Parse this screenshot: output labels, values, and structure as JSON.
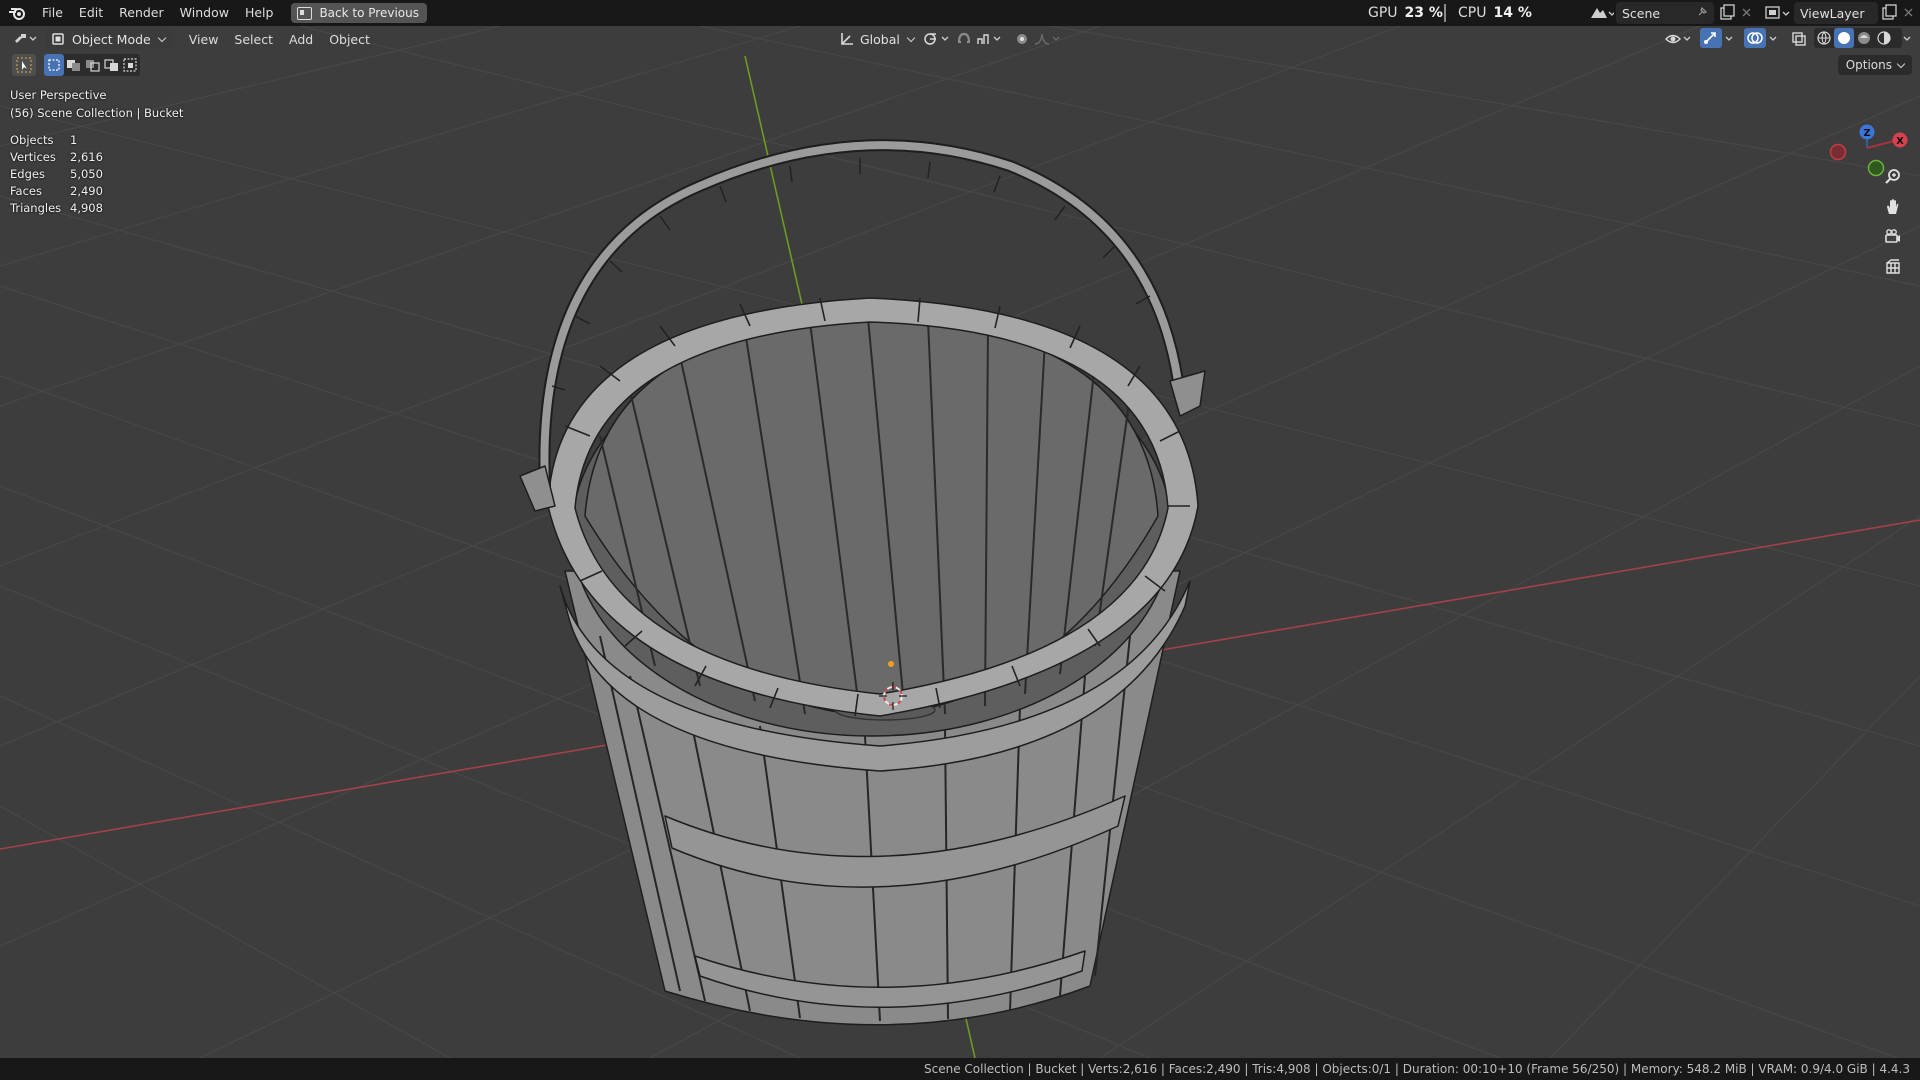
{
  "menu": {
    "items": [
      "File",
      "Edit",
      "Render",
      "Window",
      "Help"
    ],
    "back_button": "Back to Previous"
  },
  "performance": {
    "gpu_label": "GPU",
    "gpu_value": "23 %",
    "cpu_label": "CPU",
    "cpu_value": "14 %"
  },
  "scene": {
    "name": "Scene"
  },
  "view_layer": {
    "name": "ViewLayer"
  },
  "viewport_header": {
    "mode": "Object Mode",
    "menus": [
      "View",
      "Select",
      "Add",
      "Object"
    ],
    "orientation": "Global",
    "options": "Options"
  },
  "overlay": {
    "perspective": "User Perspective",
    "collection": "(56) Scene Collection | Bucket"
  },
  "stats": [
    {
      "label": "Objects",
      "value": "1"
    },
    {
      "label": "Vertices",
      "value": "2,616"
    },
    {
      "label": "Edges",
      "value": "5,050"
    },
    {
      "label": "Faces",
      "value": "2,490"
    },
    {
      "label": "Triangles",
      "value": "4,908"
    }
  ],
  "gizmo": {
    "z": "Z",
    "x": "X"
  },
  "statusbar": {
    "text": "Scene Collection | Bucket | Verts:2,616 | Faces:2,490 | Tris:4,908 | Objects:0/1 | Duration: 00:10+10 (Frame 56/250) | Memory: 548.2 MiB | VRAM: 0.9/4.0 GiB | 4.4.3"
  },
  "colors": {
    "background": "#3d3d3d",
    "grid": "#4a4a4a",
    "x_axis": "#b5474f",
    "y_axis": "#7aa62b",
    "bucket": "#8c8c8c",
    "accent_blue": "#4772b3"
  }
}
